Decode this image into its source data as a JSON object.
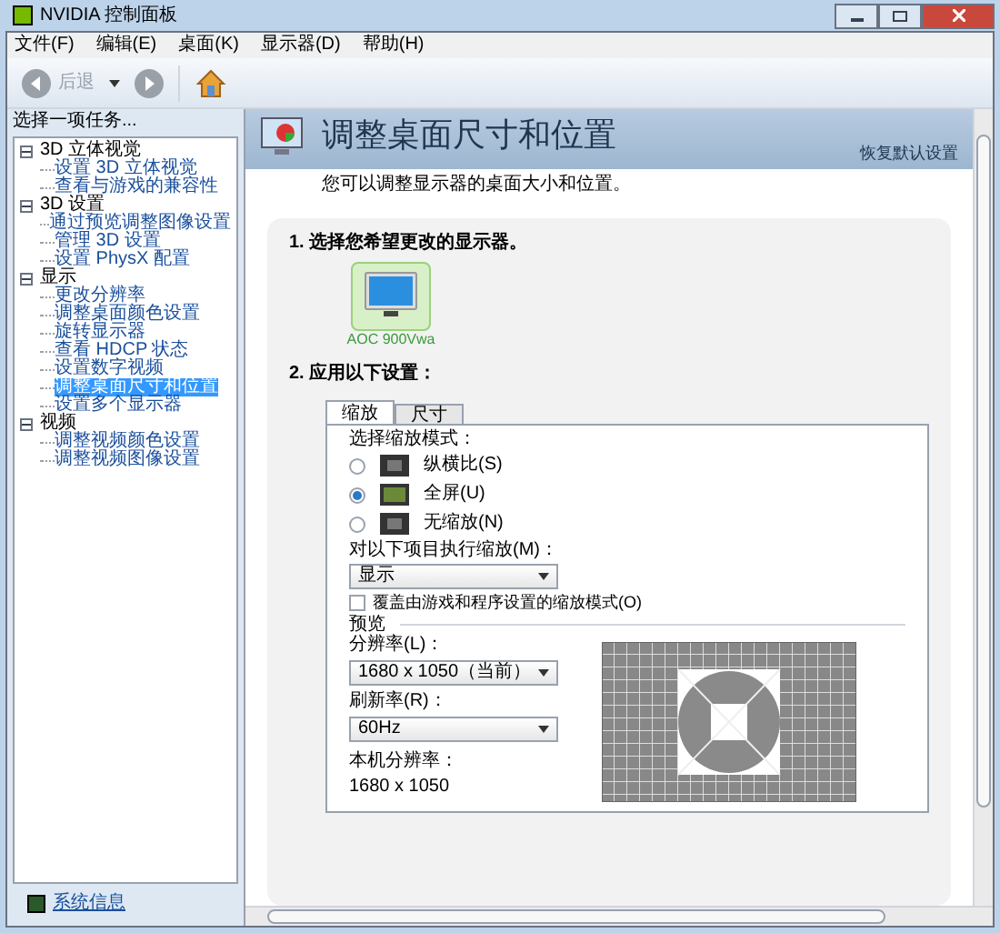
{
  "window": {
    "title": "NVIDIA 控制面板"
  },
  "menu": [
    "文件(F)",
    "编辑(E)",
    "桌面(K)",
    "显示器(D)",
    "帮助(H)"
  ],
  "toolbar": {
    "back": "后退"
  },
  "sidebar": {
    "heading": "选择一项任务...",
    "tree": [
      {
        "label": "3D 立体视觉",
        "expanded": true,
        "selected": false,
        "children": [
          {
            "label": "设置 3D 立体视觉",
            "selected": false
          },
          {
            "label": "查看与游戏的兼容性",
            "selected": false
          }
        ]
      },
      {
        "label": "3D 设置",
        "expanded": true,
        "selected": false,
        "children": [
          {
            "label": "通过预览调整图像设置",
            "selected": false
          },
          {
            "label": "管理 3D 设置",
            "selected": false
          },
          {
            "label": "设置 PhysX 配置",
            "selected": false
          }
        ]
      },
      {
        "label": "显示",
        "expanded": true,
        "selected": false,
        "children": [
          {
            "label": "更改分辨率",
            "selected": false
          },
          {
            "label": "调整桌面颜色设置",
            "selected": false
          },
          {
            "label": "旋转显示器",
            "selected": false
          },
          {
            "label": "查看 HDCP 状态",
            "selected": false
          },
          {
            "label": "设置数字视频",
            "selected": false
          },
          {
            "label": "调整桌面尺寸和位置",
            "selected": true
          },
          {
            "label": "设置多个显示器",
            "selected": false
          }
        ]
      },
      {
        "label": "视频",
        "expanded": true,
        "selected": false,
        "children": [
          {
            "label": "调整视频颜色设置",
            "selected": false
          },
          {
            "label": "调整视频图像设置",
            "selected": false
          }
        ]
      }
    ],
    "footer_link": "系统信息"
  },
  "page": {
    "title": "调整桌面尺寸和位置",
    "restore": "恢复默认设置",
    "description": "您可以调整显示器的桌面大小和位置。",
    "step1": "1. 选择您希望更改的显示器。",
    "monitor": {
      "name": "AOC 900Vwa",
      "selected": true
    },
    "step2": "2. 应用以下设置：",
    "tabs": [
      {
        "label": "缩放",
        "selected": true
      },
      {
        "label": "尺寸",
        "selected": false
      }
    ],
    "scaling": {
      "heading": "选择缩放模式：",
      "options": [
        {
          "label": "纵横比(S)",
          "selected": false
        },
        {
          "label": "全屏(U)",
          "selected": true
        },
        {
          "label": "无缩放(N)",
          "selected": false
        }
      ],
      "perform_label": "对以下项目执行缩放(M)：",
      "perform_value": "显示",
      "override": {
        "label": "覆盖由游戏和程序设置的缩放模式(O)",
        "checked": false
      }
    },
    "preview": {
      "heading": "预览",
      "resolution_label": "分辨率(L)：",
      "resolution": "1680 x 1050（当前）",
      "refresh_label": "刷新率(R)：",
      "refresh": "60Hz",
      "native_label": "本机分辨率：",
      "native": "1680 x 1050"
    }
  }
}
